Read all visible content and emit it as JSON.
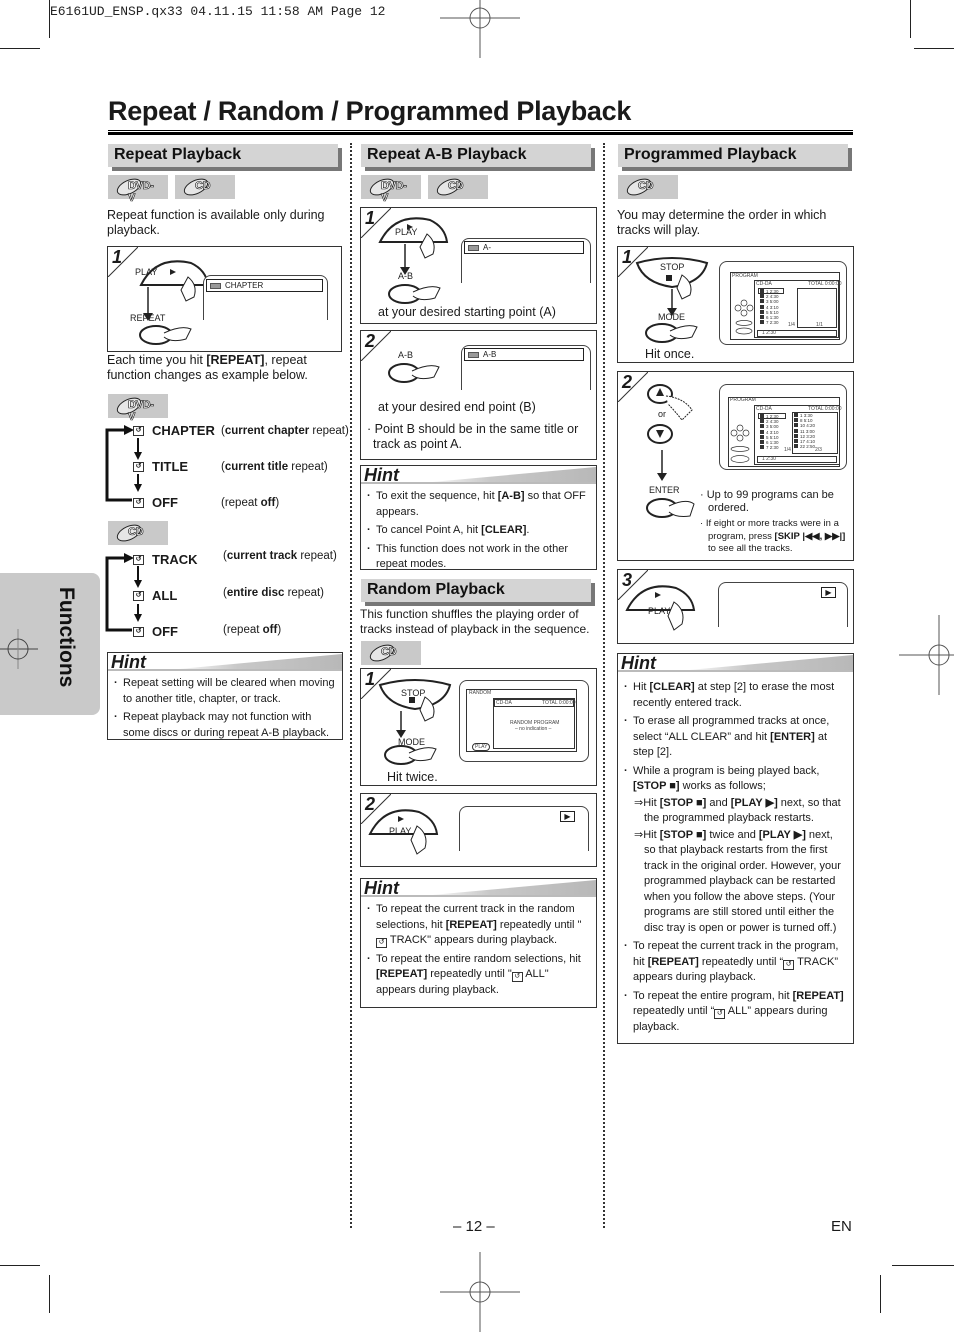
{
  "slug": "E6161UD_ENSP.qx33   04.11.15 11:58 AM   Page 12",
  "page_title": "Repeat / Random / Programmed Playback",
  "side_tab": "Functions",
  "footer": {
    "page_number": "– 12 –",
    "language": "EN"
  },
  "badges": {
    "dvd": "DVD-V",
    "cd": "CD"
  },
  "repeat": {
    "heading": "Repeat Playback",
    "intro": "Repeat function is available only during playback.",
    "step1": {
      "num": "1",
      "btn_play": "PLAY",
      "btn_repeat": "REPEAT",
      "osd": "CHAPTER"
    },
    "after_pre": "Each time you hit ",
    "after_bold": "[REPEAT]",
    "after_post": ", repeat function changes as example below.",
    "dvd_cycle": [
      {
        "label": "CHAPTER",
        "desc_bold": "current chapter",
        "desc_post": " repeat)",
        "desc_pre": "("
      },
      {
        "label": "TITLE",
        "desc_bold": "current title",
        "desc_post": " repeat)",
        "desc_pre": "("
      },
      {
        "label": "OFF",
        "desc_pre": "(repeat ",
        "desc_bold": "off",
        "desc_post": ")"
      }
    ],
    "cd_cycle": [
      {
        "label": "TRACK",
        "desc_pre": "(",
        "desc_bold": "current track",
        "desc_post": " repeat)"
      },
      {
        "label": "ALL",
        "desc_pre": "(",
        "desc_bold": "entire disc",
        "desc_post": " repeat)"
      },
      {
        "label": "OFF",
        "desc_pre": "(repeat ",
        "desc_bold": "off",
        "desc_post": ")"
      }
    ],
    "hint_title": "Hint",
    "hints": [
      "Repeat setting will be cleared when moving to another title, chapter, or track.",
      "Repeat playback may not function with some discs or during repeat A-B playback."
    ]
  },
  "ab": {
    "heading": "Repeat A-B Playback",
    "step1": {
      "num": "1",
      "btn_play": "PLAY",
      "btn_ab": "A-B",
      "osd": "A-",
      "caption": "at your desired starting point (A)"
    },
    "step2": {
      "num": "2",
      "btn_ab": "A-B",
      "osd": "A-B",
      "caption": "at your desired end point (B)",
      "note": "Point B should be in the same title or track as point A."
    },
    "hint_title": "Hint",
    "hints": [
      {
        "pre": "To exit the sequence, hit ",
        "bold": "[A-B]",
        "post": " so that OFF appears."
      },
      {
        "pre": "To cancel Point A, hit ",
        "bold": "[CLEAR]",
        "post": "."
      },
      {
        "pre": "This function does not work in the other repeat modes.",
        "bold": "",
        "post": ""
      }
    ]
  },
  "random": {
    "heading": "Random Playback",
    "intro": "This function shuffles the playing order of tracks instead of playback in the sequence.",
    "step1": {
      "num": "1",
      "btn_stop": "STOP",
      "btn_mode": "MODE",
      "caption": "Hit twice.",
      "screen_title": "RANDOM",
      "screen_disc": "CD-DA",
      "screen_total": "TOTAL 0:00:00",
      "screen_msg1": "RANDOM PROGRAM",
      "screen_msg2": "– no indication –",
      "screen_btn": "PLAY"
    },
    "step2": {
      "num": "2",
      "btn_play": "PLAY"
    },
    "hint_title": "Hint",
    "hints": [
      {
        "pre": "To repeat the current track in the random selections, hit ",
        "bold": "[REPEAT]",
        "post": " repeatedly until \"",
        "icon": true,
        "post2": " TRACK\" appears during playback."
      },
      {
        "pre": "To repeat the entire random selections, hit ",
        "bold": "[REPEAT]",
        "post": " repeatedly until \"",
        "icon": true,
        "post2": " ALL\" appears during playback."
      }
    ]
  },
  "program": {
    "heading": "Programmed Playback",
    "intro": "You may determine the order in which tracks will play.",
    "step1": {
      "num": "1",
      "btn_stop": "STOP",
      "btn_mode": "MODE",
      "caption": "Hit once.",
      "screen_title": "PROGRAM",
      "screen_disc": "CD-DA",
      "screen_total": "TOTAL 0:00:00",
      "tracks": [
        "1 2:30",
        "2 4:30",
        "3 5:00",
        "4 3:10",
        "5 5:10",
        "6 1:30",
        "7 2:30"
      ],
      "page_left": "1/4",
      "page_right": "1/1",
      "footer_track": "1 2:30"
    },
    "step2": {
      "num": "2",
      "or": "or",
      "btn_enter": "ENTER",
      "screen_title": "PROGRAM",
      "screen_disc": "CD-DA",
      "screen_total": "TOTAL 0:00:00",
      "tracks": [
        "1 2:30",
        "2 4:30",
        "3 5:00",
        "4 3:10",
        "5 5:10",
        "6 1:30",
        "7 2:30"
      ],
      "program_list": [
        "1 3:30",
        "8 5:10",
        "10 4:20",
        "11 3:00",
        "12 3:20",
        "17 4:10",
        "22 2:50"
      ],
      "page_left": "1/4",
      "page_right": "2/3",
      "footer_track": "1 2:30",
      "notes": [
        {
          "pre": "Up to 99 programs can be ordered.",
          "bold": "",
          "post": ""
        },
        {
          "pre": "If eight or more tracks were in a program, press ",
          "bold": "[SKIP |◀◀, ▶▶|]",
          "post": " to see all the tracks."
        }
      ]
    },
    "step3": {
      "num": "3",
      "btn_play": "PLAY"
    },
    "hint_title": "Hint",
    "hints": [
      {
        "html_parts": [
          [
            "Hit ",
            false
          ],
          [
            "[CLEAR]",
            true
          ],
          [
            " at step [2] to erase the most recently entered track.",
            false
          ]
        ]
      },
      {
        "html_parts": [
          [
            "To erase all programmed tracks at once, select “ALL CLEAR” and hit ",
            false
          ],
          [
            "[ENTER]",
            true
          ],
          [
            " at step [2].",
            false
          ]
        ]
      },
      {
        "html_parts": [
          [
            "While a program is being played back, ",
            false
          ],
          [
            "[STOP ■]",
            true
          ],
          [
            " works as follows;",
            false
          ]
        ]
      },
      {
        "sub": true,
        "html_parts": [
          [
            "⇒Hit ",
            false
          ],
          [
            "[STOP ■]",
            true
          ],
          [
            " and ",
            false
          ],
          [
            "[PLAY ▶]",
            true
          ],
          [
            " next, so that the programmed playback restarts.",
            false
          ]
        ]
      },
      {
        "sub": true,
        "html_parts": [
          [
            "⇒Hit ",
            false
          ],
          [
            "[STOP ■]",
            true
          ],
          [
            " twice and ",
            false
          ],
          [
            "[PLAY ▶]",
            true
          ],
          [
            " next, so that playback restarts from the first track in the original order. However, your programmed playback can be restarted when you follow the above steps. (Your programs are still stored until either the disc tray is open or power is turned off.)",
            false
          ]
        ]
      },
      {
        "html_parts": [
          [
            "To repeat the current track in the program, hit ",
            false
          ],
          [
            "[REPEAT]",
            true
          ],
          [
            " repeatedly until “",
            false
          ],
          [
            "ICON",
            false
          ],
          [
            " TRACK” appears during playback.",
            false
          ]
        ]
      },
      {
        "html_parts": [
          [
            "To repeat the entire program, hit ",
            false
          ],
          [
            "[REPEAT]",
            true
          ],
          [
            " repeatedly until “",
            false
          ],
          [
            "ICON",
            false
          ],
          [
            " ALL” appears during playback.",
            false
          ]
        ]
      }
    ]
  }
}
